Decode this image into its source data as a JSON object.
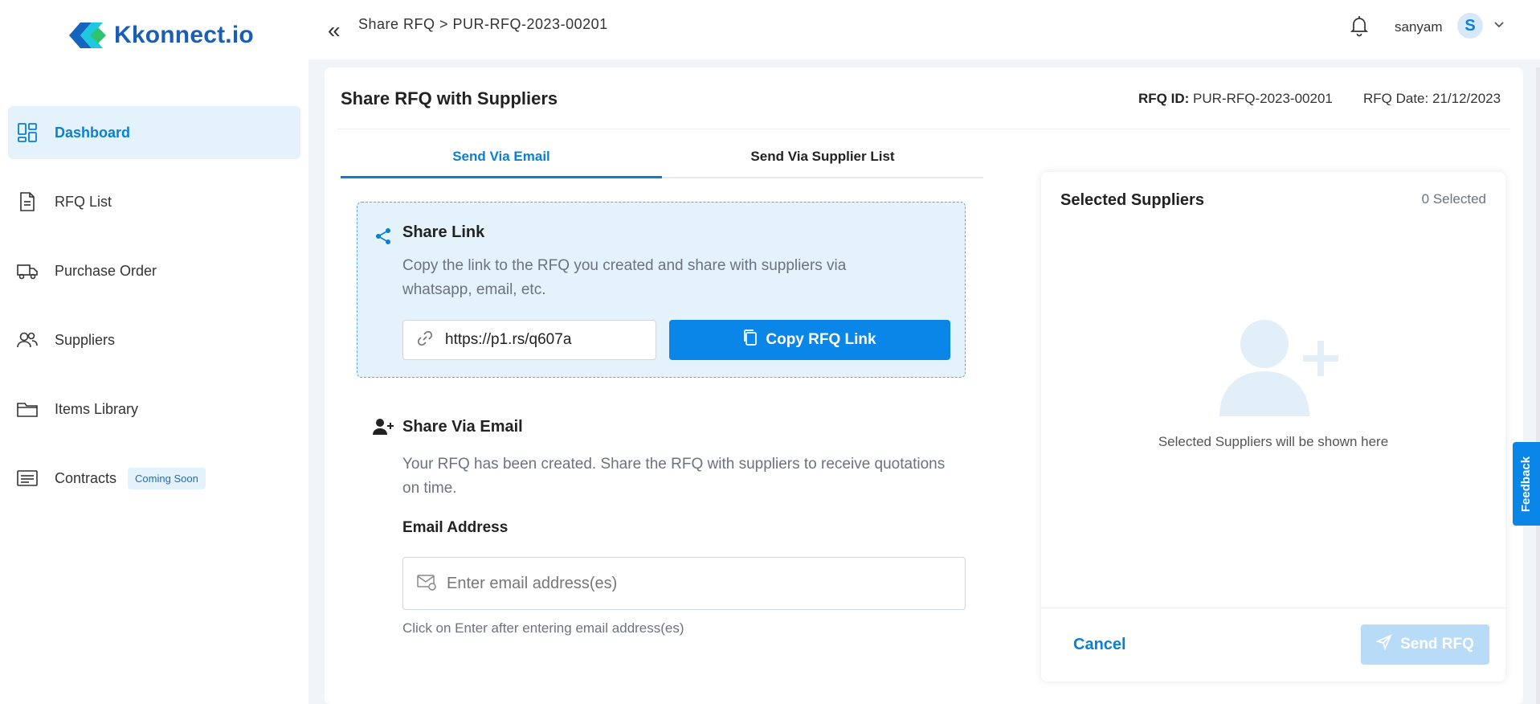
{
  "brand": {
    "name": "Kkonnect.io"
  },
  "sidebar": {
    "items": [
      {
        "label": "Dashboard",
        "icon": "dashboard-grid-icon",
        "active": true
      },
      {
        "label": "RFQ List",
        "icon": "document-icon"
      },
      {
        "label": "Purchase Order",
        "icon": "truck-icon"
      },
      {
        "label": "Suppliers",
        "icon": "users-icon"
      },
      {
        "label": "Items Library",
        "icon": "folder-icon"
      },
      {
        "label": "Contracts",
        "icon": "list-icon",
        "badge": "Coming Soon"
      }
    ]
  },
  "header": {
    "breadcrumb": "Share RFQ > PUR-RFQ-2023-00201",
    "username": "sanyam",
    "avatar_initial": "S"
  },
  "page": {
    "title": "Share RFQ with Suppliers",
    "rfq_id_label": "RFQ ID:",
    "rfq_id_value": "PUR-RFQ-2023-00201",
    "rfq_date_label": "RFQ Date:",
    "rfq_date_value": "21/12/2023"
  },
  "tabs": [
    {
      "label": "Send Via Email",
      "active": true
    },
    {
      "label": "Send Via Supplier List",
      "active": false
    }
  ],
  "share_link": {
    "title": "Share Link",
    "description": "Copy the link to the RFQ you created and share with suppliers via whatsapp, email, etc.",
    "url": "https://p1.rs/q607a",
    "copy_button": "Copy RFQ Link"
  },
  "share_email": {
    "title": "Share Via Email",
    "description": "Your RFQ has been created. Share the RFQ with suppliers to receive quotations on time.",
    "field_label": "Email Address",
    "placeholder": "Enter email address(es)",
    "hint": "Click on Enter after entering email address(es)"
  },
  "suppliers_panel": {
    "title": "Selected Suppliers",
    "count": "0 Selected",
    "empty_text": "Selected Suppliers will be shown here",
    "cancel": "Cancel",
    "send": "Send RFQ"
  },
  "feedback": "Feedback",
  "colors": {
    "accent": "#0a85e8",
    "accent_light": "#e4f2fc",
    "brand": "#1a5fb4"
  }
}
